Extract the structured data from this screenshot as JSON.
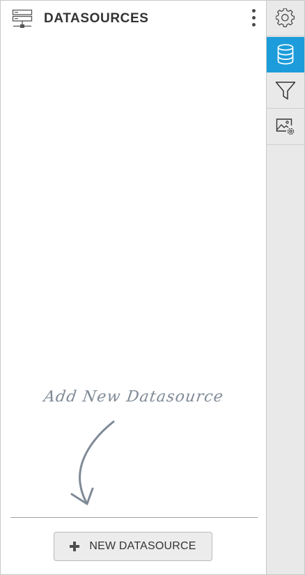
{
  "panel": {
    "title": "DATASOURCES",
    "header_icon": "server-icon",
    "menu_icon": "kebab-menu-icon",
    "hint_text": "Add New Datasource",
    "hint_icon": "curved-arrow-icon",
    "new_button": {
      "label": "NEW DATASOURCE",
      "icon": "plus-icon"
    }
  },
  "toolbar": {
    "items": [
      {
        "icon": "settings-gear-icon",
        "active": false
      },
      {
        "icon": "database-icon",
        "active": true
      },
      {
        "icon": "filter-icon",
        "active": false
      },
      {
        "icon": "image-settings-icon",
        "active": false
      }
    ]
  },
  "colors": {
    "accent": "#1c9cdb",
    "toolbar_bg": "#e9e9e9",
    "title_text": "#333333",
    "hint_text": "#7f8a96"
  }
}
